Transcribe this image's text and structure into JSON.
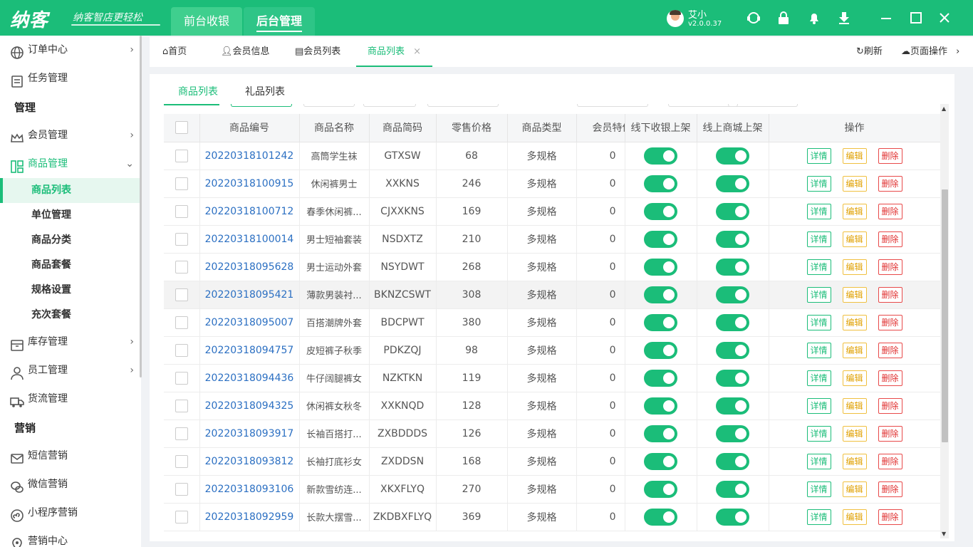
{
  "app": {
    "logo": "纳客",
    "slogan": "纳客智店更轻松"
  },
  "topnav": [
    {
      "label": "前台收银"
    },
    {
      "label": "后台管理"
    }
  ],
  "user": {
    "name": "艾小",
    "version": "v2.0.0.37"
  },
  "sidebar": {
    "items": [
      {
        "label": "订单中心"
      },
      {
        "label": "任务管理"
      },
      {
        "label": "管理"
      },
      {
        "label": "会员管理"
      },
      {
        "label": "商品管理"
      },
      {
        "label": "库存管理"
      },
      {
        "label": "员工管理"
      },
      {
        "label": "货流管理"
      },
      {
        "label": "营销"
      },
      {
        "label": "短信营销"
      },
      {
        "label": "微信营销"
      },
      {
        "label": "小程序营销"
      },
      {
        "label": "营销中心"
      }
    ],
    "subitems": [
      {
        "label": "商品列表"
      },
      {
        "label": "单位管理"
      },
      {
        "label": "商品分类"
      },
      {
        "label": "商品套餐"
      },
      {
        "label": "规格设置"
      },
      {
        "label": "充次套餐"
      }
    ]
  },
  "tabs": [
    {
      "label": "首页"
    },
    {
      "label": "会员信息"
    },
    {
      "label": "会员列表"
    },
    {
      "label": "商品列表"
    }
  ],
  "tabbar_actions": {
    "refresh": "刷新",
    "page_ops": "页面操作"
  },
  "subtabs": [
    {
      "label": "商品列表"
    },
    {
      "label": "礼品列表"
    }
  ],
  "table": {
    "headers": [
      "商品编号",
      "商品名称",
      "商品简码",
      "零售价格",
      "商品类型",
      "会员特价",
      "线下收银上架",
      "线上商城上架",
      "操作"
    ],
    "actions": {
      "detail": "详情",
      "edit": "编辑",
      "delete": "删除"
    },
    "rows": [
      {
        "code": "20220318101242",
        "name": "高筒学生袜",
        "short": "GTXSW",
        "price": "68",
        "type": "多规格",
        "member": "0"
      },
      {
        "code": "20220318100915",
        "name": "休闲裤男士",
        "short": "XXKNS",
        "price": "246",
        "type": "多规格",
        "member": "0"
      },
      {
        "code": "20220318100712",
        "name": "春季休闲裤...",
        "short": "CJXXKNS",
        "price": "169",
        "type": "多规格",
        "member": "0"
      },
      {
        "code": "20220318100014",
        "name": "男士短袖套装",
        "short": "NSDXTZ",
        "price": "210",
        "type": "多规格",
        "member": "0"
      },
      {
        "code": "20220318095628",
        "name": "男士运动外套",
        "short": "NSYDWT",
        "price": "268",
        "type": "多规格",
        "member": "0"
      },
      {
        "code": "20220318095421",
        "name": "薄款男装衬...",
        "short": "BKNZCSWT",
        "price": "308",
        "type": "多规格",
        "member": "0"
      },
      {
        "code": "20220318095007",
        "name": "百搭潮牌外套",
        "short": "BDCPWT",
        "price": "380",
        "type": "多规格",
        "member": "0"
      },
      {
        "code": "20220318094757",
        "name": "皮短裤子秋季",
        "short": "PDKZQJ",
        "price": "98",
        "type": "多规格",
        "member": "0"
      },
      {
        "code": "20220318094436",
        "name": "牛仔阔腿裤女",
        "short": "NZKTKN",
        "price": "119",
        "type": "多规格",
        "member": "0"
      },
      {
        "code": "20220318094325",
        "name": "休闲裤女秋冬",
        "short": "XXKNQD",
        "price": "128",
        "type": "多规格",
        "member": "0"
      },
      {
        "code": "20220318093917",
        "name": "长袖百搭打...",
        "short": "ZXBDDDS",
        "price": "126",
        "type": "多规格",
        "member": "0"
      },
      {
        "code": "20220318093812",
        "name": "长袖打底衫女",
        "short": "ZXDDSN",
        "price": "168",
        "type": "多规格",
        "member": "0"
      },
      {
        "code": "20220318093106",
        "name": "新款雪纺连...",
        "short": "XKXFLYQ",
        "price": "270",
        "type": "多规格",
        "member": "0"
      },
      {
        "code": "20220318092959",
        "name": "长款大摆雪...",
        "short": "ZKDBXFLYQ",
        "price": "369",
        "type": "多规格",
        "member": "0"
      }
    ]
  },
  "colors": {
    "brand": "#1bbd79",
    "link": "#2b6fc2",
    "edit": "#e0a000",
    "delete": "#e03030"
  }
}
